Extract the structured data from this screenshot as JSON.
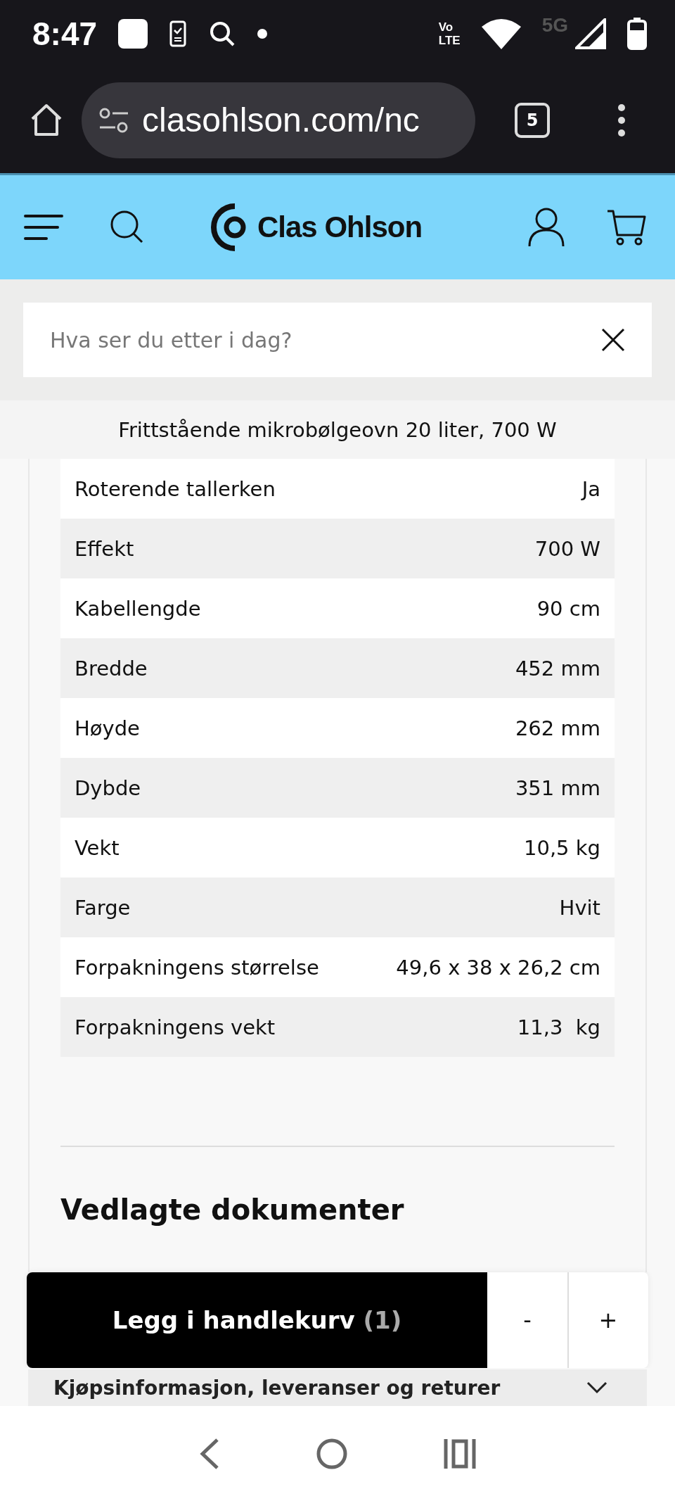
{
  "status_bar": {
    "time": "8:47",
    "volte_top": "Vo",
    "volte_bottom": "LTE",
    "network": "5G"
  },
  "browser": {
    "url": "clasohlson.com/nc",
    "tab_count": "5"
  },
  "header": {
    "logo_text": "Clas Ohlson"
  },
  "search": {
    "placeholder": "Hva ser du etter i dag?"
  },
  "product_title": "Frittstående mikrobølgeovn 20 liter, 700 W",
  "specs": [
    {
      "label": "Roterende tallerken",
      "value": "Ja"
    },
    {
      "label": "Effekt",
      "value": "700 W"
    },
    {
      "label": "Kabellengde",
      "value": "90 cm"
    },
    {
      "label": "Bredde",
      "value": "452 mm"
    },
    {
      "label": "Høyde",
      "value": "262 mm"
    },
    {
      "label": "Dybde",
      "value": "351 mm"
    },
    {
      "label": "Vekt",
      "value": "10,5 kg"
    },
    {
      "label": "Farge",
      "value": "Hvit"
    },
    {
      "label": "Forpakningens størrelse",
      "value": "49,6 x 38 x 26,2 cm"
    },
    {
      "label": "Forpakningens vekt",
      "value": "11,3  kg"
    }
  ],
  "documents_heading": "Vedlagte dokumenter",
  "cart_bar": {
    "button": "Legg i handlekurv",
    "count": "(1)",
    "minus": "-",
    "plus": "+"
  },
  "accordion": {
    "title": "Kjøpsinformasjon, leveranser og returer",
    "expanded": false
  }
}
